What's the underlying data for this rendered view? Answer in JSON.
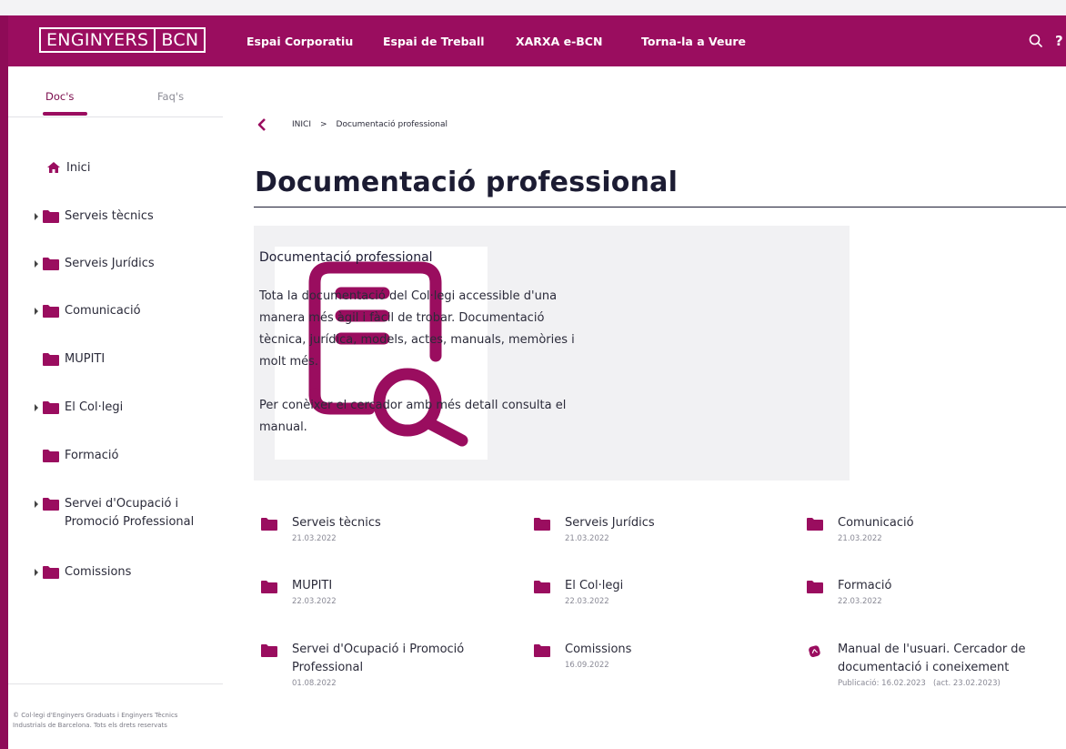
{
  "header": {
    "logo_left": "ENGINYERS",
    "logo_right": "BCN",
    "nav": [
      "Espai Corporatiu",
      "Espai de Treball",
      "XARXA e-BCN",
      "Torna-la a Veure"
    ],
    "help_label": "?"
  },
  "sidebar": {
    "tabs": [
      "Doc's",
      "Faq's"
    ],
    "active_tab": "Doc's",
    "items": [
      {
        "label": "Inici",
        "icon": "home-icon",
        "expandable": false
      },
      {
        "label": "Serveis tècnics",
        "icon": "folder-icon",
        "expandable": true
      },
      {
        "label": "Serveis Jurídics",
        "icon": "folder-icon",
        "expandable": true
      },
      {
        "label": "Comunicació",
        "icon": "folder-icon",
        "expandable": true
      },
      {
        "label": "MUPITI",
        "icon": "folder-icon",
        "expandable": false
      },
      {
        "label": "El Col·legi",
        "icon": "folder-icon",
        "expandable": true
      },
      {
        "label": "Formació",
        "icon": "folder-icon",
        "expandable": false
      },
      {
        "label": "Servei d'Ocupació i Promoció Professional",
        "icon": "folder-icon",
        "expandable": true
      },
      {
        "label": "Comissions",
        "icon": "folder-icon",
        "expandable": true
      }
    ],
    "footer": "© Col·legi d'Enginyers Graduats i Enginyers Tècnics Industrials de Barcelona. Tots els drets reservats"
  },
  "breadcrumb": {
    "home": "INICI",
    "separator": ">",
    "current": "Documentació professional"
  },
  "page": {
    "title": "Documentació professional",
    "intro_title": "Documentació professional",
    "intro_text": "Tota la documentació del Col·legi accessible d'una manera més àgil i fàcil de trobar. Documentació tècnica, jurídica, models, actes, manuals, memòries i molt més.",
    "intro_text2": "Per conèixer el cercador amb més detall consulta el manual."
  },
  "documents": [
    {
      "name": "Serveis tècnics",
      "date": "21.03.2022",
      "icon": "folder-icon"
    },
    {
      "name": "Serveis Jurídics",
      "date": "21.03.2022",
      "icon": "folder-icon"
    },
    {
      "name": "Comunicació",
      "date": "21.03.2022",
      "icon": "folder-icon"
    },
    {
      "name": "MUPITI",
      "date": "22.03.2022",
      "icon": "folder-icon"
    },
    {
      "name": "El Col·legi",
      "date": "22.03.2022",
      "icon": "folder-icon"
    },
    {
      "name": "Formació",
      "date": "22.03.2022",
      "icon": "folder-icon"
    },
    {
      "name": "Servei d'Ocupació i Promoció Professional",
      "date": "01.08.2022",
      "icon": "folder-icon"
    },
    {
      "name": "Comissions",
      "date": "16.09.2022",
      "icon": "folder-icon"
    },
    {
      "name": "Manual de l'usuari. Cercador de documentació i coneixement",
      "date": "Publicació: 16.02.2023   (act. 23.02.2023)",
      "icon": "pdf-icon"
    }
  ],
  "colors": {
    "brand": "#9a0d5f",
    "title": "#1c1c33",
    "card_bg": "#f1f1f3"
  }
}
